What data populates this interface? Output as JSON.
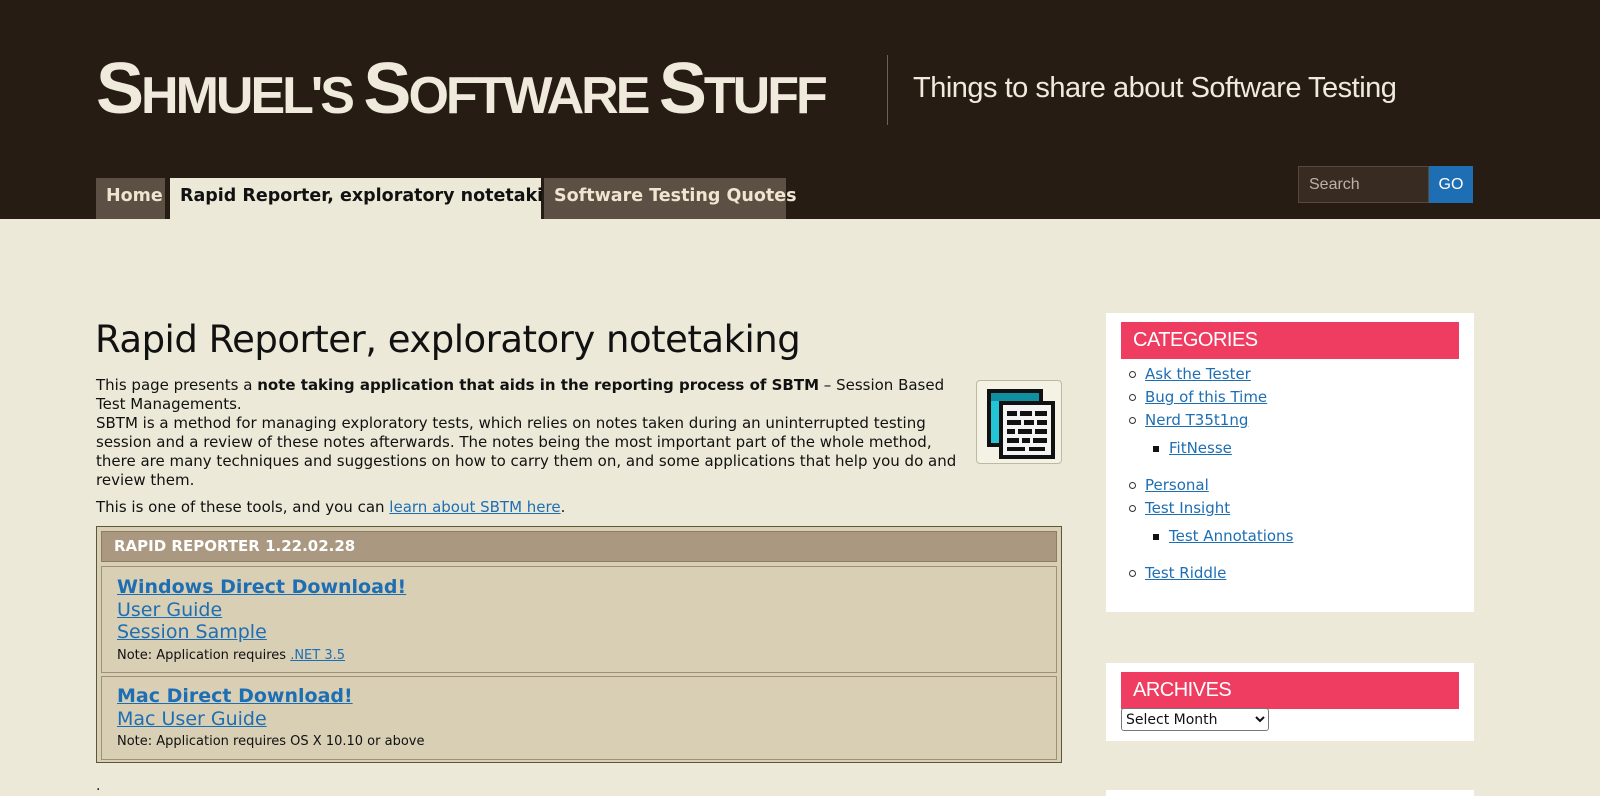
{
  "header": {
    "title_parts": [
      {
        "text": "S",
        "size": "big"
      },
      {
        "text": "HMUEL'S ",
        "size": "small"
      },
      {
        "text": "S",
        "size": "big"
      },
      {
        "text": "OFTWARE ",
        "size": "small"
      },
      {
        "text": "S",
        "size": "big"
      },
      {
        "text": "TUFF",
        "size": "small"
      }
    ],
    "tagline": "Things to share about Software Testing"
  },
  "nav": {
    "items": [
      {
        "label": "Home",
        "active": false
      },
      {
        "label": "Rapid Reporter, exploratory notetaking",
        "active": true
      },
      {
        "label": "Software Testing Quotes",
        "active": false
      }
    ]
  },
  "search": {
    "placeholder": "Search",
    "button_label": "GO"
  },
  "main": {
    "title": "Rapid Reporter, exploratory notetaking",
    "intro_prefix": "This page presents a ",
    "intro_bold": "note taking application that aids in the reporting process of SBTM",
    "intro_suffix": " – Session Based Test Managements.",
    "intro_body": "SBTM is a method for managing exploratory tests, which relies on notes taken during an uninterrupted testing session and a review of these notes afterwards. The notes being the most important part of the whole method, there are many techniques and suggestions on how to carry them on, and some applications that help you do and review them.",
    "tools_prefix": "This is one of these tools, and you can ",
    "tools_link": "learn about SBTM here",
    "tools_suffix": ".",
    "app_icon": "notepad-app-icon",
    "download_box": {
      "header": "RAPID REPORTER 1.22.02.28",
      "windows": {
        "download": "Windows Direct Download!",
        "user_guide": "User Guide",
        "sample": "Session Sample",
        "note_prefix": "Note: Application requires ",
        "note_link": ".NET 3.5"
      },
      "mac": {
        "download": "Mac Direct Download!",
        "user_guide": "Mac User Guide",
        "note": "Note: Application requires OS X 10.10 or above"
      }
    },
    "trailing": "."
  },
  "sidebar": {
    "categories_title": "CATEGORIES",
    "categories": [
      {
        "label": "Ask the Tester",
        "level": 1
      },
      {
        "label": "Bug of this Time",
        "level": 1
      },
      {
        "label": "Nerd T35t1ng",
        "level": 1
      },
      {
        "label": "FitNesse",
        "level": 2
      },
      {
        "label": "Personal",
        "level": 1
      },
      {
        "label": "Test Insight",
        "level": 1
      },
      {
        "label": "Test Annotations",
        "level": 2
      },
      {
        "label": "Test Riddle",
        "level": 1
      }
    ],
    "archives_title": "ARCHIVES",
    "archives_selected": "Select Month"
  },
  "colors": {
    "header_bg": "#271c14",
    "page_bg": "#ede9d8",
    "link": "#1e6eb4",
    "widget_title_bg": "#ee3d61",
    "search_button": "#1e6eb4"
  }
}
